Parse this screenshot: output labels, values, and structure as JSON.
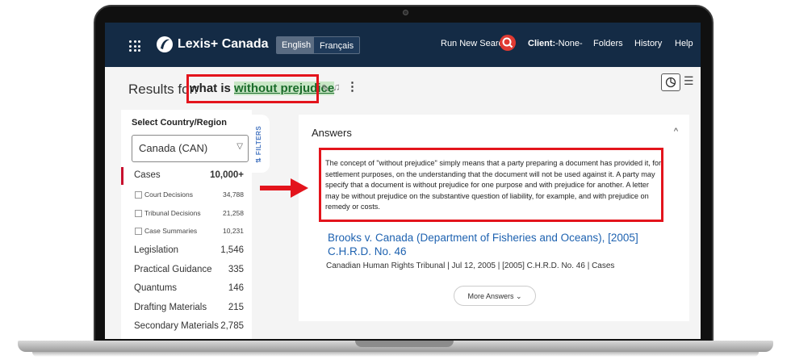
{
  "nav": {
    "brand": "Lexis+ Canada",
    "lang_en": "English",
    "lang_fr": "Français",
    "run_new_search": "Run New Search",
    "client": "Client:",
    "client_value": " -None-",
    "folders": "Folders",
    "history": "History",
    "help": "Help"
  },
  "results": {
    "prefix": "Results for:",
    "query_plain": "what is ",
    "query_highlight": "without prejudice"
  },
  "filters": {
    "select_label": "Select Country/Region",
    "selected_country": "Canada (CAN)",
    "tab_label": "FILTERS",
    "facets": [
      {
        "label": "Cases",
        "count": "10,000+"
      },
      {
        "label": "Court Decisions",
        "count": "34,788"
      },
      {
        "label": "Tribunal Decisions",
        "count": "21,258"
      },
      {
        "label": "Case Summaries",
        "count": "10,231"
      },
      {
        "label": "Legislation",
        "count": "1,546"
      },
      {
        "label": "Practical Guidance",
        "count": "335"
      },
      {
        "label": "Quantums",
        "count": "146"
      },
      {
        "label": "Drafting Materials",
        "count": "215"
      },
      {
        "label": "Secondary Materials",
        "count": "2,785"
      }
    ]
  },
  "answers": {
    "title": "Answers",
    "text": "The concept of \"without prejudice\" simply means that a party preparing a document has provided it, for settlement purposes, on the understanding that the document will not be used against it. A party may specify that a document is without prejudice for one purpose and with prejudice for another. A letter may be without prejudice on the substantive question of liability, for example, and with prejudice on remedy or costs.",
    "case_title": "Brooks v. Canada (Department of Fisheries and Oceans), [2005] C.H.R.D. No. 46",
    "case_meta": "Canadian Human Rights Tribunal | Jul 12, 2005 | [2005] C.H.R.D. No. 46 | Cases",
    "more_button": "More Answers"
  },
  "colors": {
    "nav_bg": "#142b45",
    "accent_red": "#e3141c",
    "link_blue": "#1e62b0",
    "highlight_green": "#c8e6c5"
  }
}
